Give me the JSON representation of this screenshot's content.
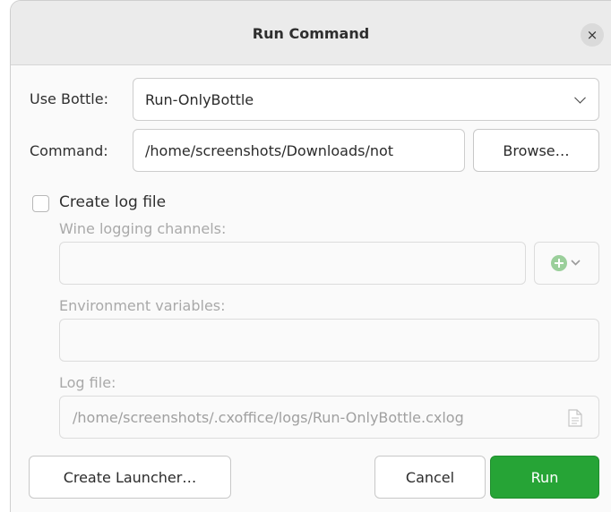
{
  "window": {
    "title": "Run Command",
    "close_glyph": "×"
  },
  "bottle": {
    "label": "Use Bottle:",
    "value": "Run-OnlyBottle"
  },
  "command": {
    "label": "Command:",
    "value": "/home/screenshots/Downloads/not",
    "browse_label": "Browse…"
  },
  "log": {
    "checkbox_label": "Create log file",
    "checked": false,
    "channels_label": "Wine logging channels:",
    "channels_value": "",
    "env_label": "Environment variables:",
    "env_value": "",
    "file_label": "Log file:",
    "file_value": "/home/screenshots/.cxoffice/logs/Run-OnlyBottle.cxlog"
  },
  "actions": {
    "create_launcher_label": "Create Launcher…",
    "cancel_label": "Cancel",
    "run_label": "Run"
  },
  "colors": {
    "accent": "#26a436",
    "add_icon": "#9bcf9b"
  },
  "icons": [
    "close-icon",
    "chevron-down-icon",
    "add-icon",
    "document-icon"
  ]
}
